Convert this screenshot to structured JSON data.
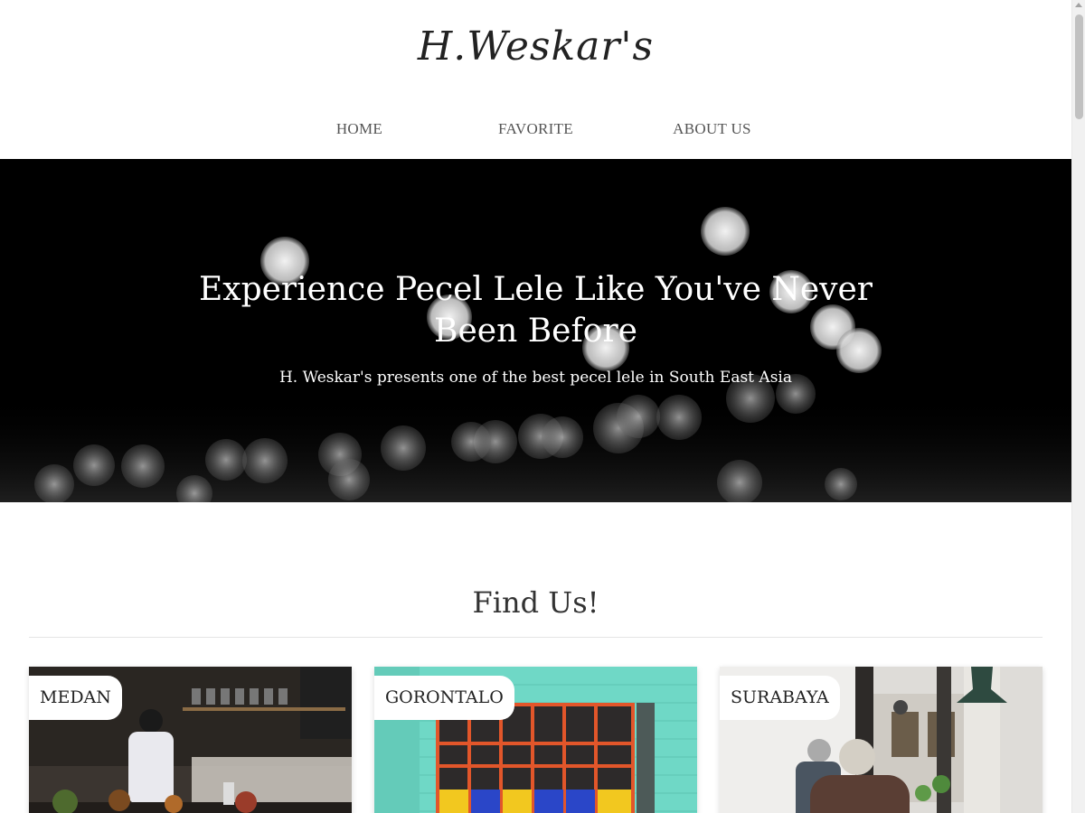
{
  "header": {
    "logo": "H.Weskar's",
    "nav": [
      {
        "label": "HOME"
      },
      {
        "label": "FAVORITE"
      },
      {
        "label": "ABOUT US"
      }
    ]
  },
  "hero": {
    "title": "Experience Pecel Lele Like You've Never Been Before",
    "subtitle": "H. Weskar's presents one of the best pecel lele in South East Asia"
  },
  "find_us": {
    "title": "Find Us!",
    "locations": [
      {
        "label": "MEDAN"
      },
      {
        "label": "GORONTALO"
      },
      {
        "label": "SURABAYA"
      }
    ]
  }
}
